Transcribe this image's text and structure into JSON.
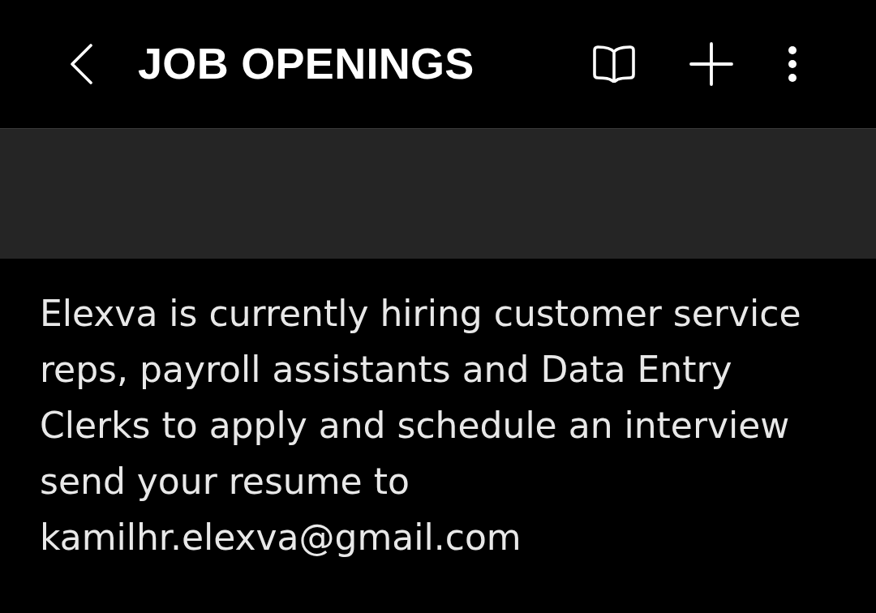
{
  "top_bar": {
    "title": "JOB OPENINGS"
  },
  "message": {
    "text": "Elexva is currently hiring customer service reps, payroll assistants and Data Entry Clerks to apply and schedule an interview send your resume to kamilhr.elexva@gmail.com"
  }
}
